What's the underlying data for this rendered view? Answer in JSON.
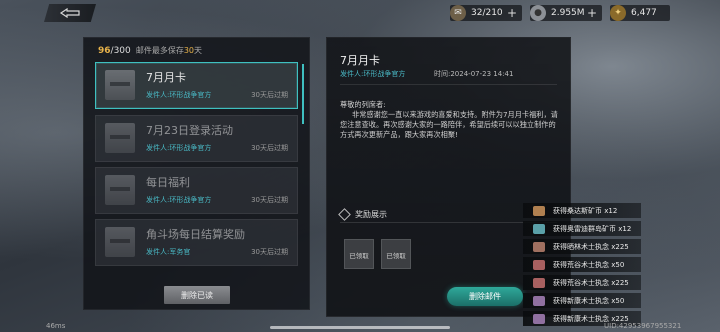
{
  "header": {
    "back_icon": "back-arrow-icon",
    "resources": [
      {
        "icon": "scroll-icon",
        "value": "32/210",
        "color": "#9a8a6a"
      },
      {
        "icon": "silver-coin-icon",
        "value": "2.955M",
        "color": "#9a9ea4"
      },
      {
        "icon": "gold-feather-icon",
        "value": "6,477",
        "color": "#c89a3a"
      }
    ]
  },
  "mailbox": {
    "count_current": "96",
    "count_total": "/300",
    "note_prefix": "邮件最多保存",
    "note_days": "30",
    "note_suffix": "天",
    "mails": [
      {
        "title": "7月月卡",
        "sender": "发件人:环形战争官方",
        "expire": "30天后过期",
        "active": true
      },
      {
        "title": "7月23日登录活动",
        "sender": "发件人:环形战争官方",
        "expire": "30天后过期",
        "active": false
      },
      {
        "title": "每日福利",
        "sender": "发件人:环形战争官方",
        "expire": "30天后过期",
        "active": false
      },
      {
        "title": "角斗场每日结算奖励",
        "sender": "发件人:军务官",
        "expire": "30天后过期",
        "active": false
      }
    ],
    "delete_read_label": "删除已读"
  },
  "detail": {
    "title": "7月月卡",
    "sender": "发件人:环形战争官方",
    "time": "时间:2024-07-23 14:41",
    "greeting": "尊敬的列席者:",
    "body": "非常感谢您一直以来游戏的喜爱和支持。附件为7月月卡福利，请您注意查收。再次感谢大家的一路陪伴，希望后续可以以独立制作的方式再次更新产品，跟大家再次相聚!",
    "rewards_title": "奖励展示",
    "reward_items": [
      {
        "label": "已领取"
      },
      {
        "label": "已领取"
      }
    ],
    "delete_label": "删除邮件"
  },
  "notifications": [
    {
      "text": "获得桑达斯矿币 x12",
      "color": "#b08050"
    },
    {
      "text": "获得奥雷迪群岛矿币 x12",
      "color": "#5aa0a8"
    },
    {
      "text": "获得晒林术士执念 x225",
      "color": "#a07060"
    },
    {
      "text": "获得荒谷术士执念 x50",
      "color": "#a86060"
    },
    {
      "text": "获得荒谷术士执念 x225",
      "color": "#a86060"
    },
    {
      "text": "获得新康术士执念 x50",
      "color": "#9070a0"
    },
    {
      "text": "获得新康术士执念 x225",
      "color": "#9070a0"
    }
  ],
  "footer": {
    "ping": "46ms",
    "uid": "UID:42953967955321"
  }
}
